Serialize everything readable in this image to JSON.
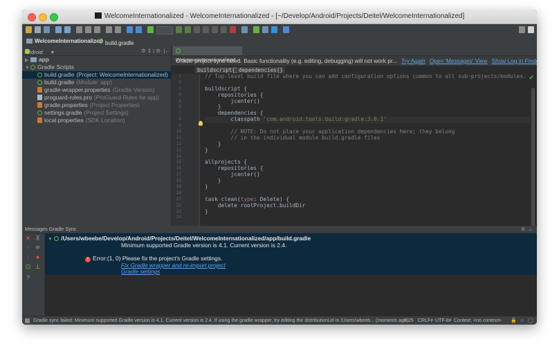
{
  "window": {
    "title": "WelcomeInternationalized - WelcomeInternationalized - [~/Develop/Android/Projects/Deitel/WelcomeInternationalized]"
  },
  "navbar": {
    "project": "WelcomeInternationalized",
    "file": "build.gradle"
  },
  "project_panel": {
    "view_selector": "Android",
    "tree": [
      {
        "label": "app",
        "note": "",
        "icon": "folder-icon",
        "level": 0
      },
      {
        "label": "Gradle Scripts",
        "note": "",
        "icon": "gradle-icon",
        "level": 0
      },
      {
        "label": "build.gradle",
        "note": "(Project: WelcomeInternationalized)",
        "icon": "gradle-icon",
        "level": 1,
        "selected": true
      },
      {
        "label": "build.gradle",
        "note": "(Module: app)",
        "icon": "gradle-icon",
        "level": 1
      },
      {
        "label": "gradle-wrapper.properties",
        "note": "(Gradle Version)",
        "icon": "properties-icon",
        "level": 1
      },
      {
        "label": "proguard-rules.pro",
        "note": "(ProGuard Rules for app)",
        "icon": "file-icon",
        "level": 1
      },
      {
        "label": "gradle.properties",
        "note": "(Project Properties)",
        "icon": "properties-icon",
        "level": 1
      },
      {
        "label": "settings.gradle",
        "note": "(Project Settings)",
        "icon": "gradle-icon",
        "level": 1
      },
      {
        "label": "local.properties",
        "note": "(SDK Location)",
        "icon": "properties-icon",
        "level": 1
      }
    ]
  },
  "editor": {
    "tab_label": "WelcomeInternationalized",
    "banner": {
      "text": "Gradle project sync failed. Basic functionality (e.g. editing, debugging) will not work pr...",
      "links": [
        "Try Again",
        "Open 'Messages' View",
        "Show Log in Finder"
      ]
    },
    "breadcrumbs": [
      "buildscript{}",
      "dependencies{}"
    ],
    "code_lines": [
      "// Top-level build file where you can add configuration options common to all sub-projects/modules.",
      "",
      "buildscript {",
      "    repositories {",
      "        jcenter()",
      "    }",
      "    dependencies {",
      "        classpath 'com.android.tools.build:gradle:3.0.1'",
      "",
      "        // NOTE: Do not place your application dependencies here; they belong",
      "        // in the individual module build.gradle files",
      "    }",
      "}",
      "",
      "allprojects {",
      "    repositories {",
      "        jcenter()",
      "    }",
      "}",
      "",
      "task clean(type: Delete) {",
      "    delete rootProject.buildDir",
      "}",
      ""
    ]
  },
  "messages": {
    "header": "Messages Gradle Sync",
    "path": "/Users/wbeebe/Develop/Android/Projects/Deitel/WelcomeInternationalized/app/build.gradle",
    "detail": "Minimum supported Gradle version is 4.1. Current version is 2.4.",
    "error_label": "Error:(1, 0)",
    "error_text": "Please fix the project's Gradle settings.",
    "link1": "Fix Gradle wrapper and re-import project",
    "link2": "Gradle settings"
  },
  "statusbar": {
    "message": "Gradle sync failed: Minimum supported Gradle version is 4.1. Current version is 2.4. If using the gradle wrapper, try editing the distributionUrl in /Users/wbeeb... (moments ago)",
    "position": "8:25",
    "line_sep": "CRLF≠",
    "encoding": "UTF-8≠",
    "context": "Context: <no context>"
  },
  "colors": {
    "accent": "#5da3e4",
    "error": "#e0524c",
    "gradle_green": "#62b543",
    "selection": "#0d293e"
  }
}
